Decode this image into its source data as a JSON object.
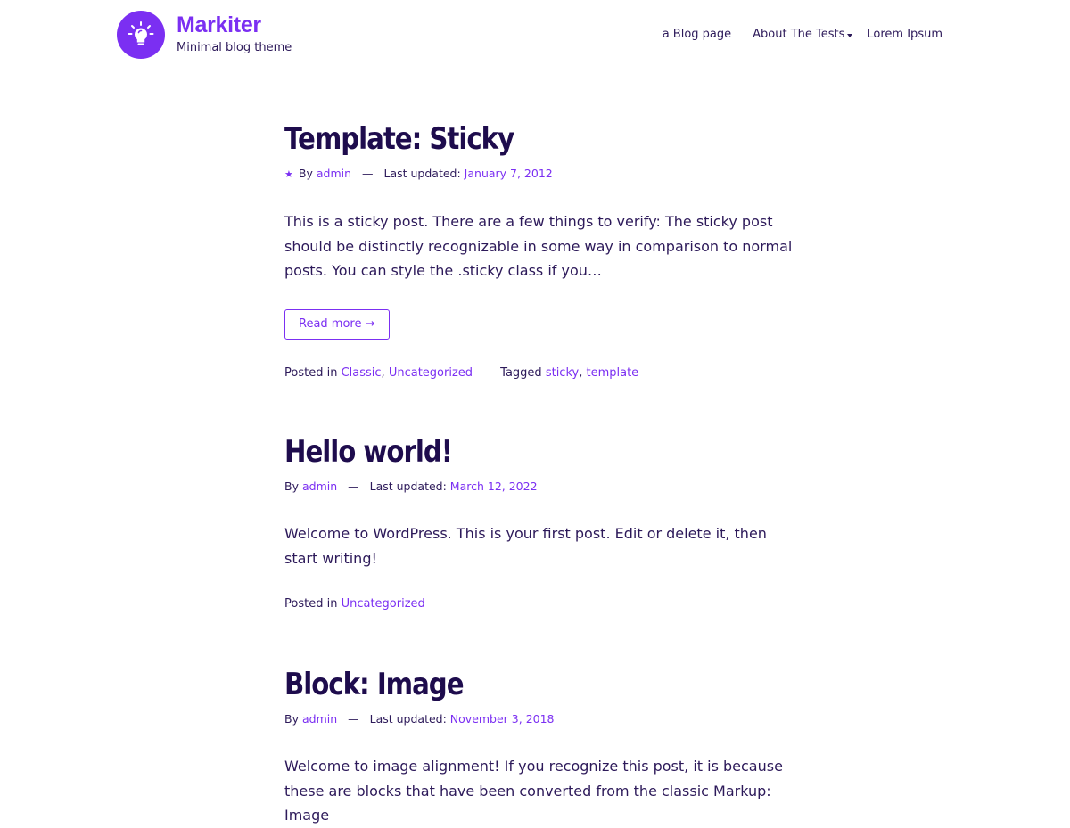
{
  "header": {
    "logo_icon": "lightbulb-icon",
    "title": "Markiter",
    "tagline": "Minimal blog theme",
    "brand_color": "#7b2ff2",
    "nav": [
      {
        "label": "a Blog page"
      },
      {
        "label": "About The Tests",
        "has_submenu": true
      },
      {
        "label": "Lorem Ipsum"
      }
    ]
  },
  "posts": [
    {
      "title": "Template: Sticky",
      "sticky_icon": "star-icon",
      "sticky_glyph": "★",
      "by_label": "By",
      "author": "admin",
      "dash": "—",
      "updated_label": "Last updated:",
      "date": "January 7, 2012",
      "excerpt": "This is a sticky post. There are a few things to verify: The sticky post should be distinctly recognizable in some way in comparison to normal posts. You can style the .sticky class if you…",
      "read_more": "Read more →",
      "posted_in_label": "Posted in",
      "categories": [
        "Classic",
        "Uncategorized"
      ],
      "comma": ",",
      "tagged_label": "Tagged",
      "tags": [
        "sticky",
        "template"
      ]
    },
    {
      "title": "Hello world!",
      "by_label": "By",
      "author": "admin",
      "dash": "—",
      "updated_label": "Last updated:",
      "date": "March 12, 2022",
      "excerpt": "Welcome to WordPress. This is your first post. Edit or delete it, then start writing!",
      "posted_in_label": "Posted in",
      "categories": [
        "Uncategorized"
      ]
    },
    {
      "title": "Block: Image",
      "by_label": "By",
      "author": "admin",
      "dash": "—",
      "updated_label": "Last updated:",
      "date": "November 3, 2018",
      "excerpt": "Welcome to image alignment! If you recognize this post, it is because these are blocks that have been converted from the classic Markup: Image"
    }
  ]
}
